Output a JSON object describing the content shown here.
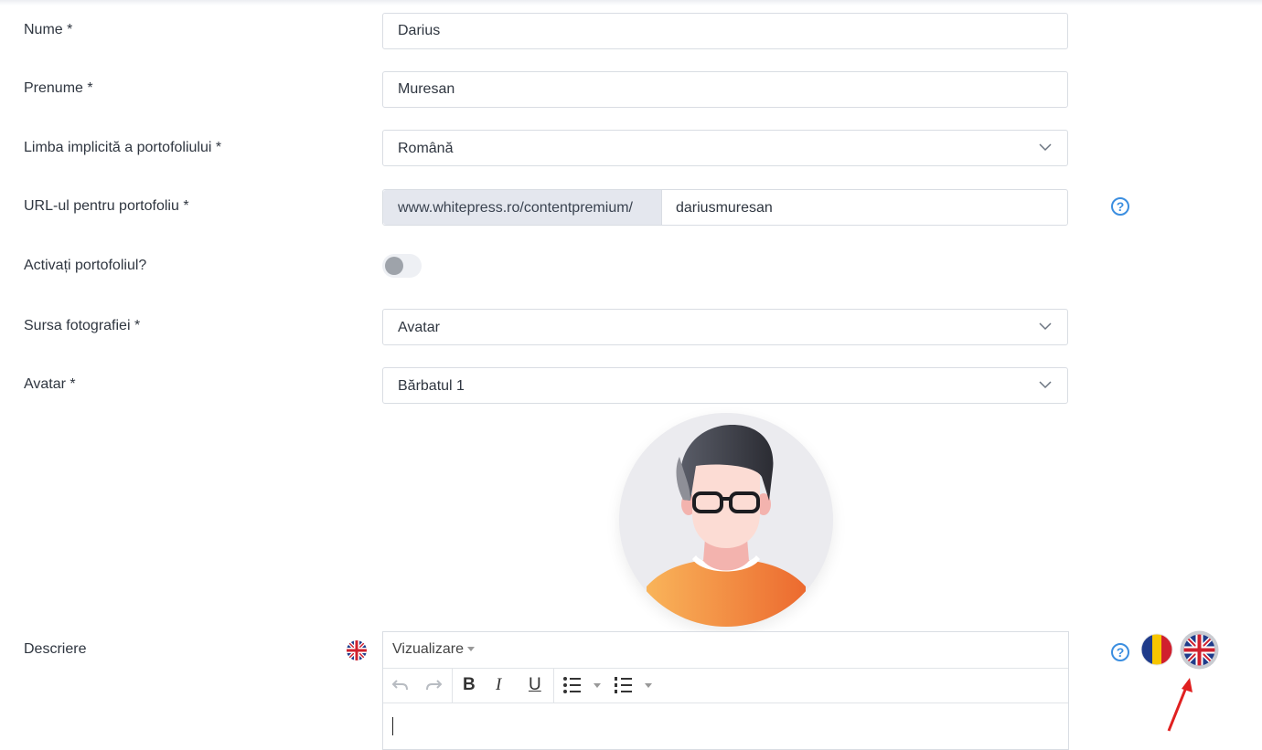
{
  "form": {
    "name": {
      "label": "Nume *",
      "value": "Darius"
    },
    "surname": {
      "label": "Prenume *",
      "value": "Muresan"
    },
    "language": {
      "label": "Limba implicită a portofoliului *",
      "value": "Română"
    },
    "url": {
      "label": "URL-ul pentru portofoliu *",
      "prefix": "www.whitepress.ro/contentpremium/",
      "value": "dariusmuresan"
    },
    "activate": {
      "label": "Activați portofoliul?",
      "enabled": false
    },
    "photo_source": {
      "label": "Sursa fotografiei *",
      "value": "Avatar"
    },
    "avatar": {
      "label": "Avatar *",
      "value": "Bărbatul 1"
    },
    "description": {
      "label": "Descriere"
    }
  },
  "editor": {
    "menu_label": "Vizualizare",
    "toolbar": {
      "undo_icon": "undo-icon",
      "redo_icon": "redo-icon",
      "bold": "B",
      "italic": "I",
      "underline": "U",
      "bullet_list_icon": "bullet-list-icon",
      "numbered_list_icon": "numbered-list-icon"
    }
  },
  "help_symbol": "?",
  "colors": {
    "accent": "#3b8ee0",
    "border": "#d9dde3",
    "url_prefix_bg": "#e4e7ee",
    "arrow": "#e02020"
  },
  "icons": {
    "dropdown": "chevron-down-icon",
    "help": "question-circle-icon",
    "flags": [
      "flag-uk-icon",
      "flag-ro-icon",
      "flag-uk-selected-icon"
    ]
  }
}
